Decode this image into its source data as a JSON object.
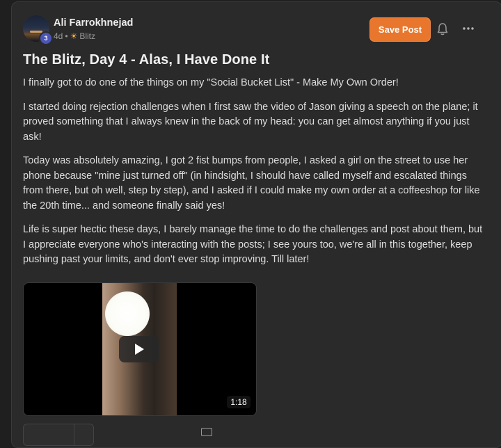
{
  "post": {
    "author": "Ali Farrokhnejad",
    "level": "3",
    "age": "4d",
    "separator": "•",
    "community_icon": "sun-icon",
    "community": "Blitz",
    "title": "The Blitz, Day 4 - Alas, I Have Done It",
    "paragraphs": [
      "I finally got to do one of the things on my \"Social Bucket List\" - Make My Own Order!",
      "I started doing rejection challenges when I first saw the video of Jason giving a speech on the plane; it proved something that I always knew in the back of my head: you can get almost anything if you just ask!",
      "Today was absolutely amazing, I got 2 fist bumps from people, I asked a girl on the street to use her phone because \"mine just turned off\" (in hindsight, I should have called myself and escalated things from there, but oh well, step by step), and I asked if I could make my own order at a coffeeshop for like the 20th time... and someone finally said yes!",
      "Life is super hectic these days, I barely manage the time to do the challenges and post about them, but I appreciate everyone who's interacting with the posts; I see yours too, we're all in this together, keep pushing past your limits, and don't ever stop improving. Till later!"
    ],
    "video": {
      "duration": "1:18"
    }
  },
  "actions": {
    "save_label": "Save Post",
    "bell_icon": "bell-icon",
    "more_icon": "more-icon"
  },
  "colors": {
    "accent": "#e8772d",
    "background": "#2a2a2b",
    "level_badge": "#4b55b5"
  }
}
